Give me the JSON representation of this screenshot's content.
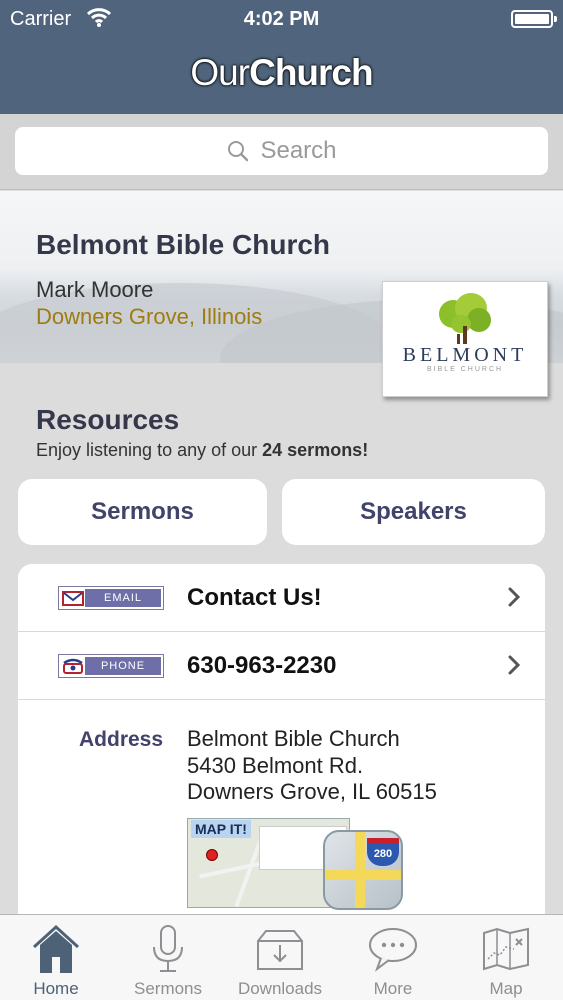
{
  "status_bar": {
    "carrier": "Carrier",
    "time": "4:02 PM",
    "battery_level": 1.0
  },
  "nav": {
    "title_light": "Our",
    "title_bold": "Church"
  },
  "search": {
    "placeholder": "Search"
  },
  "church": {
    "name": "Belmont Bible Church",
    "pastor": "Mark Moore",
    "location": "Downers Grove, Illinois",
    "logo_text": "BELMONT",
    "logo_subtext": "BIBLE CHURCH"
  },
  "resources": {
    "title": "Resources",
    "subtitle_prefix": "Enjoy listening to any of our ",
    "subtitle_bold": "24 sermons!",
    "buttons": {
      "sermons": "Sermons",
      "speakers": "Speakers"
    }
  },
  "contact": {
    "email_tag": "EMAIL",
    "email_label": "Contact Us!",
    "phone_tag": "PHONE",
    "phone_number": "630-963-2230",
    "address_label": "Address",
    "address_lines": [
      "Belmont Bible Church",
      "5430 Belmont Rd.",
      "Downers Grove, IL 60515"
    ],
    "map_button_text": "MAP IT!",
    "map_highway": "280"
  },
  "tabs": [
    {
      "label": "Home",
      "icon": "home-icon",
      "active": true
    },
    {
      "label": "Sermons",
      "icon": "microphone-icon",
      "active": false
    },
    {
      "label": "Downloads",
      "icon": "download-tray-icon",
      "active": false
    },
    {
      "label": "More",
      "icon": "chat-bubble-icon",
      "active": false
    },
    {
      "label": "Map",
      "icon": "folded-map-icon",
      "active": false
    }
  ],
  "colors": {
    "nav_bg": "#50657d",
    "accent": "#42426a",
    "location": "#a07b10",
    "tab_active": "#4d6276"
  }
}
